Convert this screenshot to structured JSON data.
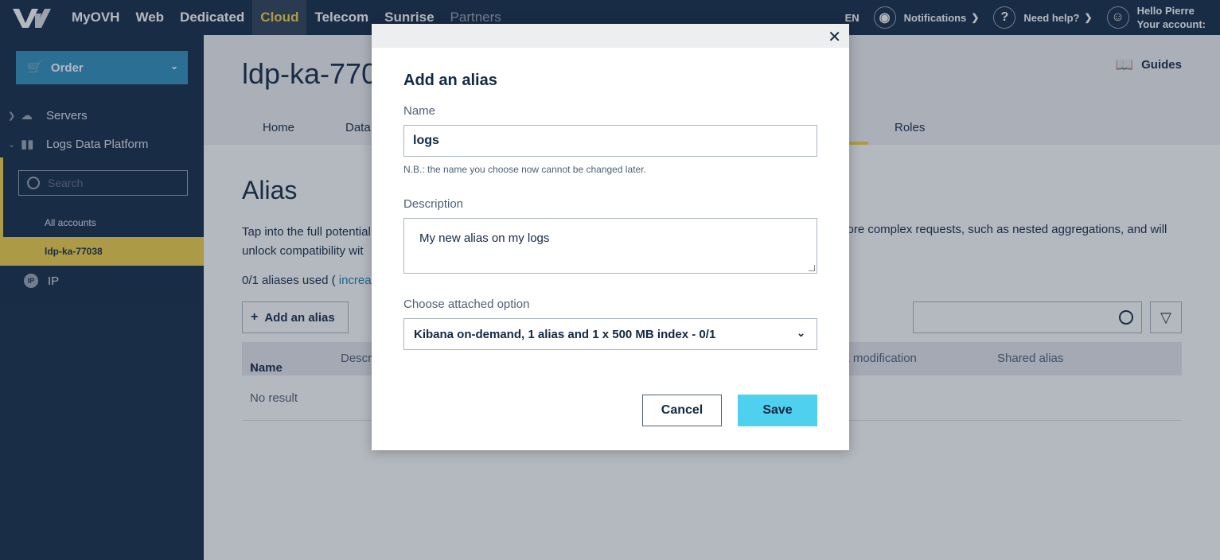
{
  "topbar": {
    "nav": [
      "MyOVH",
      "Web",
      "Dedicated",
      "Cloud",
      "Telecom",
      "Sunrise",
      "Partners"
    ],
    "active_nav": "Cloud",
    "lang": "EN",
    "notifications": "Notifications",
    "help": "Need help?",
    "account_greeting": "Hello Pierre",
    "account_label": "Your account:"
  },
  "sidebar": {
    "order": "Order",
    "servers": "Servers",
    "logs": "Logs Data Platform",
    "search_placeholder": "Search",
    "all_accounts": "All accounts",
    "active_account": "ldp-ka-77038",
    "ip": "IP"
  },
  "main": {
    "title": "ldp-ka-770",
    "guides": "Guides",
    "tabs": [
      "Home",
      "Data",
      "Roles"
    ],
    "section_title": "Alias",
    "desc_left_line1": "Tap into the full potential",
    "desc_left_line2": "unlock compatibility wit",
    "desc_right": "more complex requests, such as nested aggregations, and will",
    "usage_prefix": "0/1 aliases used ( ",
    "usage_link": "increas",
    "add_alias": "Add an alias",
    "columns": [
      "Name",
      "Descr",
      "st modification",
      "Shared alias"
    ],
    "no_result": "No result"
  },
  "modal": {
    "title": "Add an alias",
    "name_label": "Name",
    "name_value": "logs",
    "name_hint": "N.B.: the name you choose now cannot be changed later.",
    "description_label": "Description",
    "description_value": "My new alias on my logs",
    "option_label": "Choose attached option",
    "option_value": "Kibana on-demand, 1 alias and 1 x 500 MB index - 0/1",
    "cancel": "Cancel",
    "save": "Save"
  },
  "colors": {
    "navy": "#122844",
    "accent_yellow": "#f4d245",
    "order_blue": "#2e8fbf",
    "save_cyan": "#4fd0ee"
  }
}
